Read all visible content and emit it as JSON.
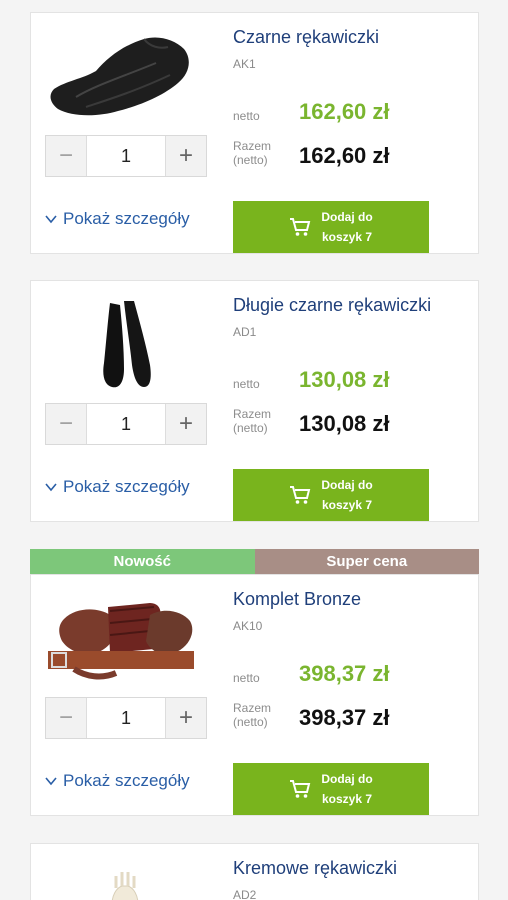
{
  "colors": {
    "accent_green": "#79b41d",
    "price_green": "#7ab52f",
    "title_blue": "#1f3f7a",
    "badge_new": "#7dc77a",
    "badge_super": "#a88e86"
  },
  "labels": {
    "netto": "netto",
    "razem": "Razem\n(netto)",
    "details": "Pokaż szczegóły",
    "cart_line1": "Dodaj do",
    "cart_line2": "koszyk 7"
  },
  "products": [
    {
      "name": "Czarne rękawiczki",
      "sku": "AK1",
      "price_netto": "162,60 zł",
      "price_total": "162,60 zł",
      "qty": "1",
      "image_icon": "black-gloves-image"
    },
    {
      "name": "Długie czarne rękawiczki",
      "sku": "AD1",
      "price_netto": "130,08 zł",
      "price_total": "130,08 zł",
      "qty": "1",
      "image_icon": "long-black-gloves-image"
    },
    {
      "name": "Komplet Bronze",
      "sku": "AK10",
      "price_netto": "398,37 zł",
      "price_total": "398,37 zł",
      "qty": "1",
      "image_icon": "bronze-set-image",
      "badges": [
        "Nowość",
        "Super cena"
      ]
    },
    {
      "name": "Kremowe rękawiczki",
      "sku": "AD2",
      "image_icon": "cream-gloves-image"
    }
  ]
}
